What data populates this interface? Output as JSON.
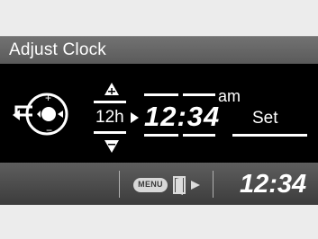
{
  "title": "Adjust Clock",
  "editor": {
    "mode": "12h",
    "time": "12:34",
    "meridiem": "am",
    "set_label": "Set"
  },
  "statusbar": {
    "menu_label": "MENU",
    "clock": "12:34"
  },
  "colors": {
    "title_bar": "#666666",
    "panel": "#000000",
    "status_bar": "#4a4a4a",
    "text": "#ffffff"
  },
  "icons": {
    "joystick": "joystick-back-icon",
    "increment": "triangle-up-icon",
    "decrement": "triangle-down-icon",
    "next": "arrow-right-icon",
    "menu": "menu-button-icon",
    "exit": "exit-door-icon"
  }
}
